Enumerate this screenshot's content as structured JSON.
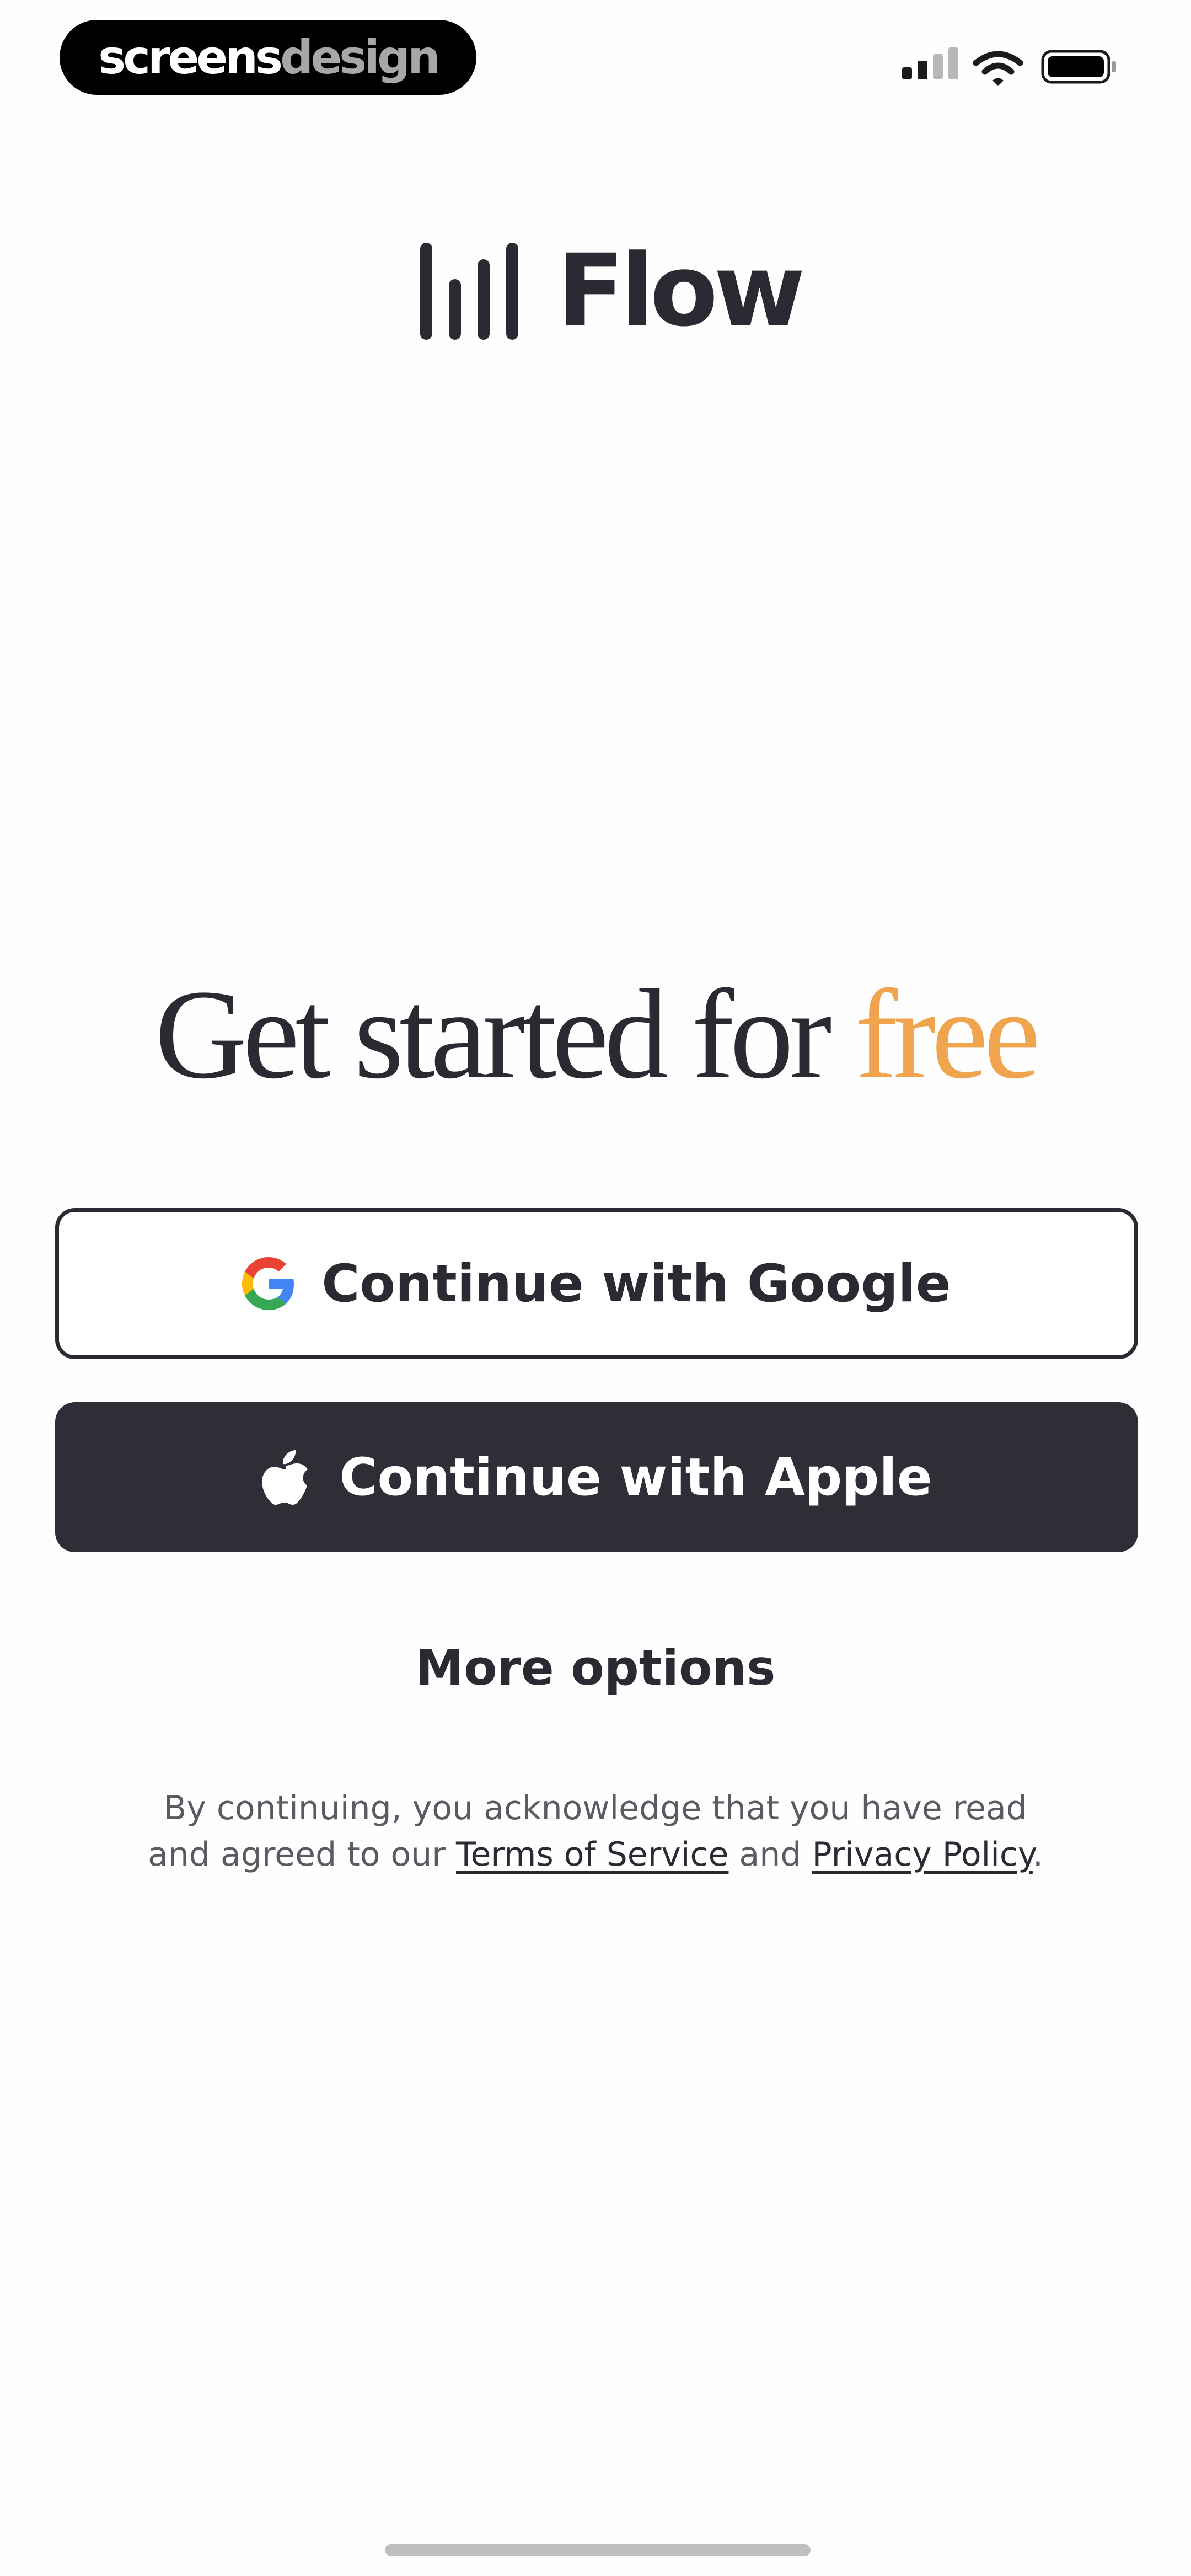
{
  "watermark": {
    "part1": "screens",
    "part2": "design"
  },
  "status_bar": {
    "signal_icon": "cellular-signal-icon",
    "wifi_icon": "wifi-icon",
    "battery_icon": "battery-icon"
  },
  "brand": {
    "name": "Flow",
    "logo_icon": "audio-bars-logo-icon"
  },
  "headline": {
    "text": "Get started for ",
    "accent": "free"
  },
  "buttons": {
    "google": {
      "label": "Continue with Google",
      "icon": "google-icon"
    },
    "apple": {
      "label": "Continue with Apple",
      "icon": "apple-icon"
    }
  },
  "more_options": {
    "label": "More options"
  },
  "legal": {
    "line1": "By continuing, you acknowledge that you have read",
    "line2_prefix": "and agreed to our ",
    "terms_link": "Terms of Service",
    "and": " and ",
    "privacy_link": "Privacy Policy",
    "suffix": "."
  },
  "colors": {
    "text": "#2b2a33",
    "accent": "#f0a44e",
    "apple_button": "#2f2d36"
  }
}
